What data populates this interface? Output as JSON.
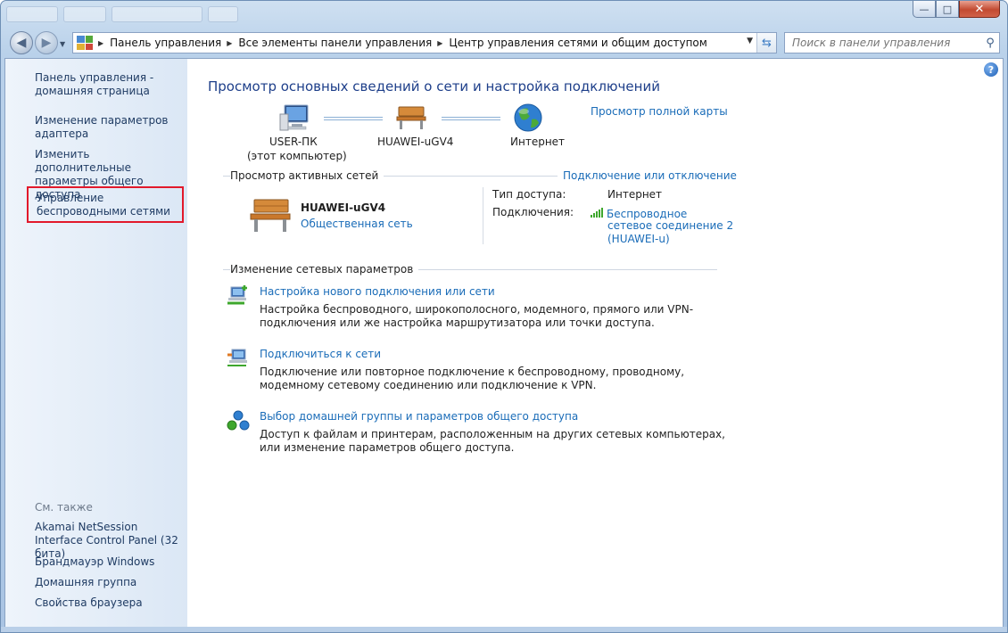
{
  "window": {
    "minimize_glyph": "—",
    "maximize_glyph": "□",
    "close_glyph": "✕"
  },
  "nav": {
    "back_glyph": "◀",
    "forward_glyph": "▶",
    "breadcrumbs": [
      "Панель управления",
      "Все элементы панели управления",
      "Центр управления сетями и общим доступом"
    ],
    "search_placeholder": "Поиск в панели управления"
  },
  "sidebar": {
    "items": [
      {
        "label": "Панель управления - домашняя страница"
      },
      {
        "label": "Изменение параметров адаптера"
      },
      {
        "label": "Изменить дополнительные параметры общего доступа"
      },
      {
        "label": "Управление беспроводными сетями",
        "highlighted": true
      }
    ],
    "see_also_title": "См. также",
    "see_also": [
      {
        "label": "Akamai NetSession Interface Control Panel (32 бита)"
      },
      {
        "label": "Брандмауэр Windows"
      },
      {
        "label": "Домашняя группа"
      },
      {
        "label": "Свойства браузера"
      }
    ]
  },
  "main": {
    "help_glyph": "?",
    "title": "Просмотр основных сведений о сети и настройка подключений",
    "full_map_link": "Просмотр полной карты",
    "network_map": {
      "computer_name": "USER-ПК",
      "computer_sub": "(этот компьютер)",
      "network_name": "HUAWEI-uGV4",
      "internet_label": "Интернет"
    },
    "active_networks": {
      "section_title": "Просмотр активных сетей",
      "connect_link": "Подключение или отключение",
      "network_name": "HUAWEI-uGV4",
      "network_type": "Общественная сеть",
      "access_type_label": "Тип доступа:",
      "access_type_value": "Интернет",
      "connections_label": "Подключения:",
      "connection_lines": [
        "Беспроводное",
        "сетевое соединение 2",
        "(HUAWEI-u)"
      ]
    },
    "change_settings": {
      "section_title": "Изменение сетевых параметров",
      "tasks": [
        {
          "icon": "new-connection-icon",
          "title": "Настройка нового подключения или сети",
          "description": "Настройка беспроводного, широкополосного, модемного, прямого или VPN-подключения или же настройка маршрутизатора или точки доступа."
        },
        {
          "icon": "connect-network-icon",
          "title": "Подключиться к сети",
          "description": "Подключение или повторное подключение к беспроводному, проводному, модемному сетевому соединению или подключение к VPN."
        },
        {
          "icon": "homegroup-icon",
          "title": "Выбор домашней группы и параметров общего доступа",
          "description": "Доступ к файлам и принтерам, расположенным на других сетевых компьютерах, или изменение параметров общего доступа."
        }
      ]
    }
  },
  "colors": {
    "link": "#1a6cb8",
    "title": "#1e3f8a",
    "highlight_border": "#e2192b",
    "signal": "#3ea72d"
  }
}
